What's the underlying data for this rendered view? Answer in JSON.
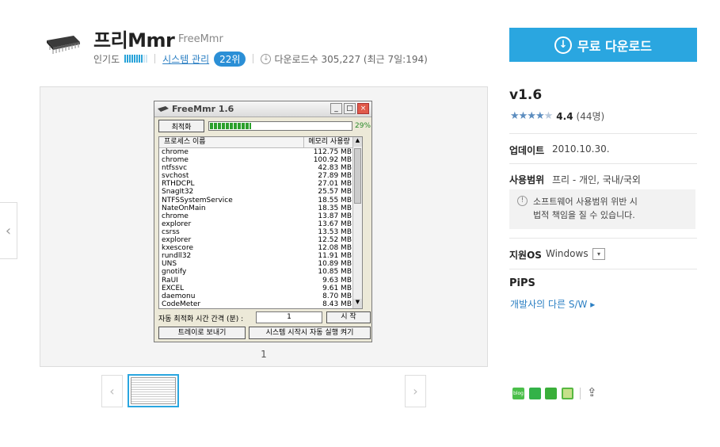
{
  "header": {
    "title": "프리Mmr",
    "subtitle": "FreeMmr",
    "popularity_label": "인기도",
    "popularity_level": 0.8,
    "category": "시스템 관리",
    "rank": "22위",
    "download_label": "다운로드수 305,227 (최근 7일:194)",
    "download_button": "무료 다운로드"
  },
  "viewer": {
    "page_number": "1",
    "app_window": {
      "title": "FreeMmr 1.6",
      "optimize_button": "최적화",
      "progress_percent": "29%",
      "progress_value": 0.29,
      "col_process": "프로세스 이름",
      "col_memory": "메모리 사용량",
      "rows": [
        {
          "name": "chrome",
          "mem": "112.75 MB"
        },
        {
          "name": "chrome",
          "mem": "100.92 MB"
        },
        {
          "name": "ntfssvc",
          "mem": "42.83 MB"
        },
        {
          "name": "svchost",
          "mem": "27.89 MB"
        },
        {
          "name": "RTHDCPL",
          "mem": "27.01 MB"
        },
        {
          "name": "SnagIt32",
          "mem": "25.57 MB"
        },
        {
          "name": "NTFSSystemService",
          "mem": "18.55 MB"
        },
        {
          "name": "NateOnMain",
          "mem": "18.35 MB"
        },
        {
          "name": "chrome",
          "mem": "13.87 MB"
        },
        {
          "name": "explorer",
          "mem": "13.67 MB"
        },
        {
          "name": "csrss",
          "mem": "13.53 MB"
        },
        {
          "name": "explorer",
          "mem": "12.52 MB"
        },
        {
          "name": "kxescore",
          "mem": "12.08 MB"
        },
        {
          "name": "rundll32",
          "mem": "11.91 MB"
        },
        {
          "name": "UNS",
          "mem": "10.89 MB"
        },
        {
          "name": "gnotify",
          "mem": "10.85 MB"
        },
        {
          "name": "RaUI",
          "mem": "9.63 MB"
        },
        {
          "name": "EXCEL",
          "mem": "9.61 MB"
        },
        {
          "name": "daemonu",
          "mem": "8.70 MB"
        },
        {
          "name": "CodeMeter",
          "mem": "8.43 MB"
        }
      ],
      "interval_label": "자동 최적화 시간 간격 (분) :",
      "interval_value": "1",
      "start_button": "시 작",
      "tray_button": "트레이로 보내기",
      "autostart_button": "시스템 시작시 자동 실행 켜기"
    }
  },
  "info": {
    "version": "v1.6",
    "rating": 4.4,
    "rating_score": "4.4",
    "rating_count": "(44명)",
    "update_label": "업데이트",
    "update_value": "2010.10.30.",
    "license_label": "사용범위",
    "license_value": "프리 - 개인, 국내/국외",
    "notice_line1": "소프트웨어 사용범위 위반 시",
    "notice_line2": "법적 책임을 질 수 있습니다.",
    "os_label": "지원OS",
    "os_value": "Windows",
    "pips_title": "PiPS",
    "dev_link": "개발사의 다른 S/W ▸"
  },
  "icons": {
    "share": [
      "blog-icon",
      "cafe-icon",
      "bookmark-icon",
      "memo-icon",
      "share-icon"
    ]
  }
}
